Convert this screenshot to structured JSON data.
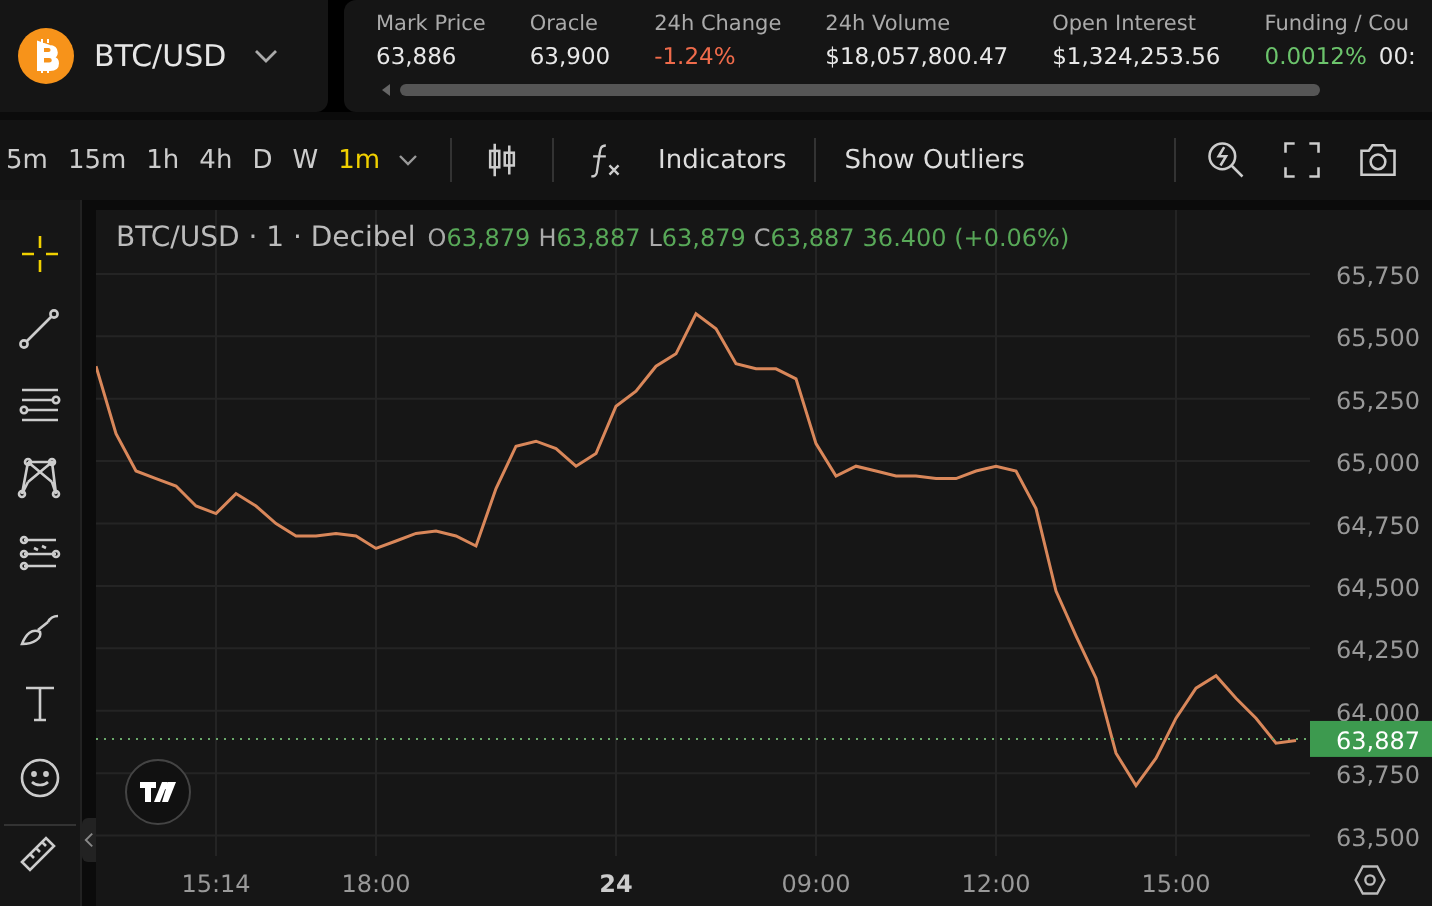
{
  "market": {
    "symbol": "BTC/USD"
  },
  "stats": [
    {
      "label": "Mark Price",
      "value": "63,886"
    },
    {
      "label": "Oracle",
      "value": "63,900"
    },
    {
      "label": "24h Change",
      "value": "-1.24%",
      "color": "#ef6b4b"
    },
    {
      "label": "24h Volume",
      "value": "$18,057,800.47"
    },
    {
      "label": "Open Interest",
      "value": "$1,324,253.56"
    },
    {
      "label": "Funding / Cou",
      "value": "0.0012%",
      "extra": "00:",
      "color": "#6cc46c"
    }
  ],
  "intervals": [
    {
      "label": "5m",
      "selected": false
    },
    {
      "label": "15m",
      "selected": false
    },
    {
      "label": "1h",
      "selected": false
    },
    {
      "label": "4h",
      "selected": false
    },
    {
      "label": "D",
      "selected": false
    },
    {
      "label": "W",
      "selected": false
    },
    {
      "label": "1m",
      "selected": true
    }
  ],
  "toolbar": {
    "indicators": "Indicators",
    "outliers": "Show Outliers"
  },
  "tools": [
    {
      "kind": "crosshair",
      "selected": true
    },
    {
      "kind": "trendline",
      "selected": false
    },
    {
      "kind": "hlines",
      "selected": false
    },
    {
      "kind": "pattern",
      "selected": false
    },
    {
      "kind": "fib",
      "selected": false
    },
    {
      "kind": "brush",
      "selected": false
    },
    {
      "kind": "text",
      "selected": false
    },
    {
      "kind": "emoji",
      "selected": false
    },
    {
      "kind": "ruler",
      "selected": false
    }
  ],
  "legend": {
    "title": "BTC/USD · 1 · Decibel",
    "ohlc": [
      {
        "key": "O",
        "value": "63,879"
      },
      {
        "key": "H",
        "value": "63,887"
      },
      {
        "key": "L",
        "value": "63,879"
      },
      {
        "key": "C",
        "value": "63,887"
      }
    ],
    "change": "36.400 (+0.06%)"
  },
  "chart_data": {
    "type": "line",
    "ylim": [
      63418,
      66006
    ],
    "categories": [
      null,
      null,
      null,
      null,
      null,
      null,
      "15:14",
      null,
      null,
      null,
      null,
      null,
      null,
      null,
      "18:00",
      null,
      null,
      null,
      null,
      null,
      null,
      null,
      null,
      null,
      null,
      null,
      "24",
      null,
      null,
      null,
      null,
      null,
      null,
      null,
      null,
      null,
      "09:00",
      null,
      null,
      null,
      null,
      null,
      null,
      null,
      null,
      "12:00",
      null,
      null,
      null,
      null,
      null,
      null,
      null,
      null,
      "15:00",
      null,
      null,
      null,
      null,
      null,
      null
    ],
    "yticks": [
      {
        "value": 63500,
        "label": "63,500"
      },
      {
        "value": 63750,
        "label": "63,750"
      },
      {
        "value": 64000,
        "label": "64,000"
      },
      {
        "value": 64250,
        "label": "64,250"
      },
      {
        "value": 64500,
        "label": "64,500"
      },
      {
        "value": 64750,
        "label": "64,750"
      },
      {
        "value": 65000,
        "label": "65,000"
      },
      {
        "value": 65250,
        "label": "65,250"
      },
      {
        "value": 65500,
        "label": "65,500"
      },
      {
        "value": 65750,
        "label": "65,750"
      }
    ],
    "values": [
      65380,
      65110,
      64960,
      64930,
      64900,
      64820,
      64790,
      64870,
      64820,
      64750,
      64700,
      64700,
      64710,
      64700,
      64650,
      64680,
      64710,
      64720,
      64700,
      64660,
      64890,
      65060,
      65080,
      65050,
      64980,
      65030,
      65220,
      65280,
      65380,
      65430,
      65590,
      65530,
      65390,
      65370,
      65370,
      65330,
      65070,
      64940,
      64980,
      64960,
      64940,
      64940,
      64930,
      64930,
      64960,
      64980,
      64960,
      64810,
      64480,
      64300,
      64130,
      63830,
      63700,
      63810,
      63970,
      64090,
      64140,
      64050,
      63970,
      63870,
      63880
    ],
    "grid": true,
    "ref_lines": [
      {
        "axis": "y",
        "value": 63887,
        "label": "63,887"
      }
    ]
  }
}
